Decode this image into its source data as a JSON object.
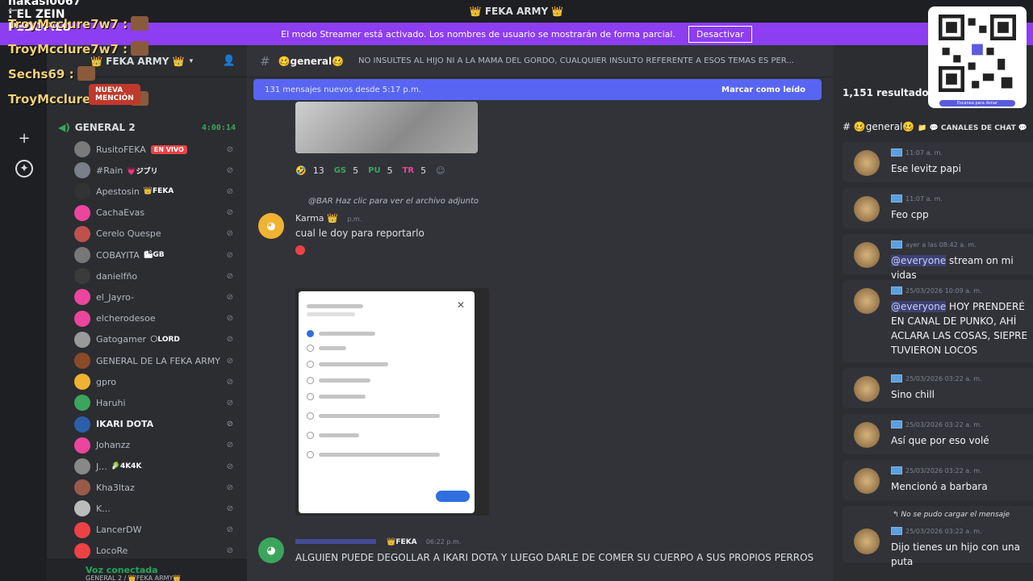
{
  "titlebar": {
    "title": "👑 FEKA ARMY 👑"
  },
  "streamer_banner": {
    "message": "El modo Streamer está activado. Los nombres de usuario se mostrarán de forma parcial.",
    "button": "Desactivar"
  },
  "server": {
    "name": "👑 FEKA ARMY 👑"
  },
  "voice_channel": {
    "name": "GENERAL 2",
    "timer": "4:00:14",
    "users": [
      {
        "name": "RusitoFEKA",
        "tag": "",
        "live": "EN VIVO",
        "color": "#7a7a7a",
        "bold": false
      },
      {
        "name": "#Rain",
        "tag": "💗ジブリ",
        "live": "",
        "color": "#7a7f8a",
        "bold": false
      },
      {
        "name": "Apestosin",
        "tag": "👑FEKA",
        "live": "",
        "color": "#333333",
        "bold": false
      },
      {
        "name": "CachaEvas",
        "tag": "",
        "live": "",
        "color": "#eb459e",
        "bold": false
      },
      {
        "name": "Cerelo Quespe",
        "tag": "",
        "live": "",
        "color": "#c0504d",
        "bold": false
      },
      {
        "name": "COBAYITA",
        "tag": "🏙GB",
        "live": "",
        "color": "#777777",
        "bold": false
      },
      {
        "name": "danielfño",
        "tag": "",
        "live": "",
        "color": "#3b3b3b",
        "bold": false
      },
      {
        "name": "el_Jayro-",
        "tag": "",
        "live": "",
        "color": "#eb459e",
        "bold": false
      },
      {
        "name": "elcherodesoe",
        "tag": "",
        "live": "",
        "color": "#eb459e",
        "bold": false
      },
      {
        "name": "Gatogamer",
        "tag": "🌕LORD",
        "live": "",
        "color": "#9a9a9a",
        "bold": false
      },
      {
        "name": "GENERAL DE LA FEKA ARMY",
        "tag": "",
        "live": "",
        "color": "#8a4a2a",
        "bold": false
      },
      {
        "name": "gpro",
        "tag": "",
        "live": "",
        "color": "#f0b232",
        "bold": false
      },
      {
        "name": "Haruhi",
        "tag": "",
        "live": "",
        "color": "#3ba55c",
        "bold": false
      },
      {
        "name": "IKARI DOTA",
        "tag": "",
        "live": "",
        "color": "#2b5fa8",
        "bold": true
      },
      {
        "name": "Johanzz",
        "tag": "",
        "live": "",
        "color": "#eb459e",
        "bold": false
      },
      {
        "name": "J...",
        "tag": "🥬4K4K",
        "live": "",
        "color": "#888888",
        "bold": false
      },
      {
        "name": "Kha3ltaz",
        "tag": "",
        "live": "",
        "color": "#9a5a4a",
        "bold": false
      },
      {
        "name": "K...",
        "tag": "",
        "live": "",
        "color": "#bbbbbb",
        "bold": false
      },
      {
        "name": "LancerDW",
        "tag": "",
        "live": "",
        "color": "#ed4245",
        "bold": false
      },
      {
        "name": "LocoRe",
        "tag": "",
        "live": "",
        "color": "#ed4245",
        "bold": false
      }
    ]
  },
  "voice_status": {
    "title": "Voz conectada",
    "sub": "GENERAL 2 / 👑FEKA ARMY👑"
  },
  "chat": {
    "channel": "🥴general🥴",
    "topic": "NO INSULTES AL HIJO NI A LA MAMÁ DEL GORDO, CUALQUIER INSULTO REFERENTE A ESOS TEMAS ES PER...",
    "new_messages": "131 mensajes nuevos desde 5:17 p.m.",
    "mark_read": "Marcar como leído",
    "reactions": [
      {
        "emoji": "🤣",
        "count": "13"
      },
      {
        "emoji": "GS",
        "count": "5"
      },
      {
        "emoji": "PU",
        "count": "5"
      },
      {
        "emoji": "TR",
        "count": "5"
      }
    ],
    "reply_preview": "@BAR Haz clic para ver el archivo adjunto",
    "message1": {
      "author": "Karma 👑",
      "time": "p.m.",
      "text": "cual le doy para reportarlo"
    },
    "message2": {
      "tag": "👑FEKA",
      "time": "06:22 p.m.",
      "text": "ALGUIEN PUEDE DEGOLLAR A IKARI DOTA Y LUEGO DARLE DE COMER SU CUERPO A SUS PROPIOS PERROS"
    }
  },
  "results": {
    "count": "1,151 resultados",
    "channel": "# 🥴general🥴",
    "category": "📁 💬 CANALES DE CHAT 💬",
    "items": [
      {
        "time": "11:07 a. m.",
        "mention": "",
        "text": "Ese levitz papi",
        "reply": ""
      },
      {
        "time": "11:07 a. m.",
        "mention": "",
        "text": "Feo cpp",
        "reply": ""
      },
      {
        "time": "ayer a las 08:42 a. m.",
        "mention": "@everyone",
        "text": " stream on mi vidas",
        "reply": ""
      },
      {
        "time": "25/03/2026 10:09 a. m.",
        "mention": "@everyone",
        "text": " HOY PRENDERÉ EN CANAL DE PUNKO, AHÍ ACLARA LAS COSAS, SIEPRE TUVIERON LOCOS",
        "reply": ""
      },
      {
        "time": "25/03/2026 03:22 a. m.",
        "mention": "",
        "text": "Sino chill",
        "reply": ""
      },
      {
        "time": "25/03/2026 03:22 a. m.",
        "mention": "",
        "text": "Así que por eso volé",
        "reply": ""
      },
      {
        "time": "25/03/2026 03:22 a. m.",
        "mention": "",
        "text": "Mencionó a barbara",
        "reply": ""
      },
      {
        "time": "25/03/2026 03:22 a. m.",
        "mention": "",
        "text": "Dijo tienes un hijo con una puta",
        "reply": "↰ No se pudo cargar el mensaje"
      }
    ]
  },
  "overlay": {
    "top": "nakasi0067 : EL ZEIN PEDOFILO",
    "lines": [
      "TroyMcclure7w7 :",
      "TroyMcclure7w7 :",
      "Sechs69 :",
      "TroyMcclure7w7 :"
    ],
    "mention_badge": "NUEVA MENCIÓN",
    "qr_caption": "Escanea para donar"
  }
}
